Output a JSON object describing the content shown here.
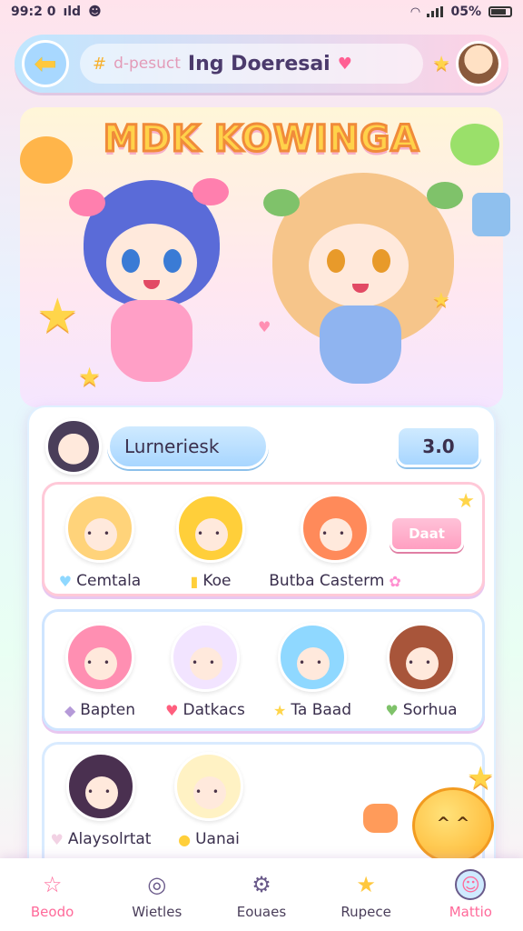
{
  "status_bar": {
    "time": "99:2 0",
    "carrier": "ıld",
    "battery": "05%"
  },
  "header": {
    "hashtag": "#",
    "subtitle": "d-pesuct",
    "title": "Ing Doeresai",
    "heart": "♥"
  },
  "hero": {
    "title": "MDK KOWINGA"
  },
  "panel": {
    "user_name": "Lurneriesk",
    "score": "3.0",
    "action_label": "Daat",
    "rows": [
      [
        {
          "name": "Cemtala",
          "icon": "♥",
          "color": "#ffd37a"
        },
        {
          "name": "Koe",
          "icon": "▮",
          "color": "#ffcf3a"
        },
        {
          "name": "Butba Casterm",
          "icon": "",
          "color": "#ff8a5a"
        }
      ],
      [
        {
          "name": "Bapten",
          "icon": "◆",
          "color": "#ff8fb2"
        },
        {
          "name": "Datkacs",
          "icon": "♥",
          "color": "#f2e4ff"
        },
        {
          "name": "Ta Baad",
          "icon": "★",
          "color": "#8fd8ff"
        },
        {
          "name": "Sorhua",
          "icon": "♥",
          "color": "#a8553a"
        }
      ],
      [
        {
          "name": "Alaysolrtat",
          "icon": "♥",
          "color": "#4a3050"
        },
        {
          "name": "Uanai",
          "icon": "●",
          "color": "#fff2c4"
        }
      ]
    ]
  },
  "nav": [
    {
      "label": "Beodo",
      "icon": "☆"
    },
    {
      "label": "Wietles",
      "icon": "◎"
    },
    {
      "label": "Eouaes",
      "icon": "⚙"
    },
    {
      "label": "Rupece",
      "icon": "★"
    },
    {
      "label": "Mattio",
      "icon": "☺"
    }
  ]
}
